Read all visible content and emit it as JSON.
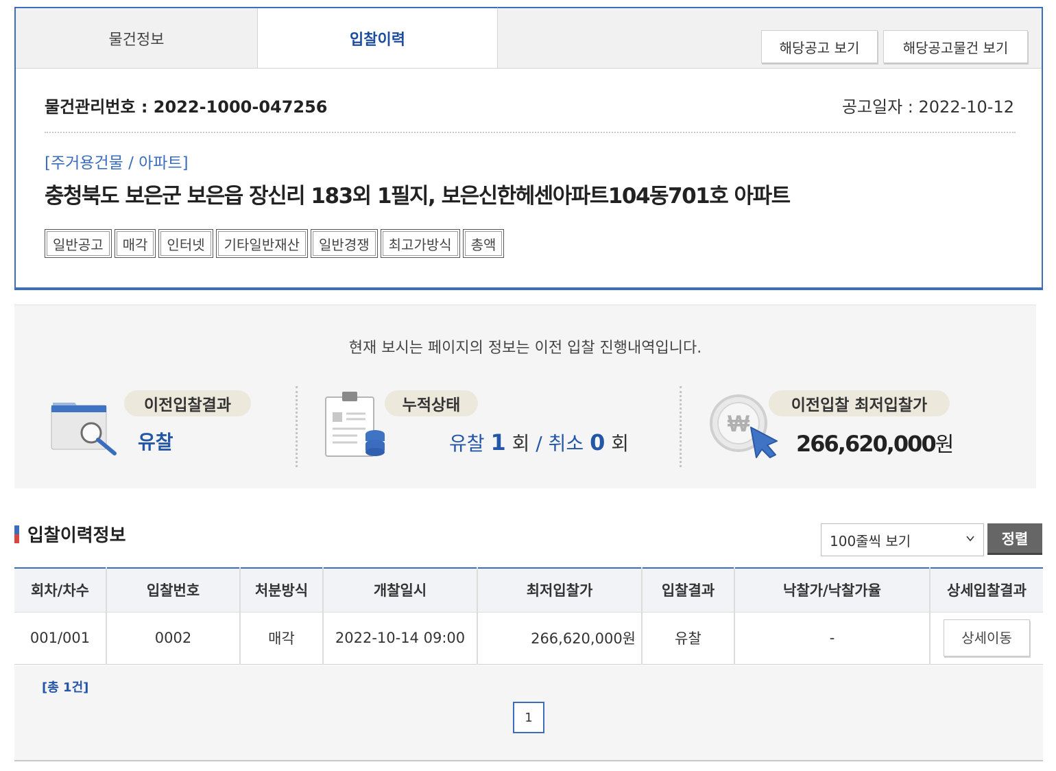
{
  "tabs": [
    {
      "label": "물건정보",
      "active": false
    },
    {
      "label": "입찰이력",
      "active": true
    }
  ],
  "header_buttons": {
    "notice_view": "해당공고 보기",
    "notice_items_view": "해당공고물건 보기"
  },
  "item": {
    "management_number_label": "물건관리번호 :",
    "management_number": "2022-1000-047256",
    "notice_date_label": "공고일자 :",
    "notice_date": "2022-10-12",
    "category": "[주거용건물 / 아파트]",
    "address": "충청북도 보은군 보은읍 장신리 183외 1필지, 보은신한헤센아파트104동701호 아파트",
    "tags": [
      "일반공고",
      "매각",
      "인터넷",
      "기타일반재산",
      "일반경쟁",
      "최고가방식",
      "총액"
    ]
  },
  "summary": {
    "notice": "현재 보시는 페이지의 정보는 이전 입찰 진행내역입니다.",
    "prev_result_label": "이전입찰결과",
    "prev_result_value": "유찰",
    "cumulative_label": "누적상태",
    "fail_label": "유찰",
    "fail_count": "1",
    "times_unit": "회",
    "separator": "/",
    "cancel_label": "취소",
    "cancel_count": "0",
    "min_price_label": "이전입찰 최저입찰가",
    "min_price_value": "266,620,000",
    "won": "원"
  },
  "section": {
    "title": "입찰이력정보",
    "rows_select": "100줄씩 보기",
    "sort_button": "정렬"
  },
  "table": {
    "headers": [
      "회차/차수",
      "입찰번호",
      "처분방식",
      "개찰일시",
      "최저입찰가",
      "입찰결과",
      "낙찰가/낙찰가율",
      "상세입찰결과"
    ],
    "rows": [
      {
        "round": "001/001",
        "bid_no": "0002",
        "method": "매각",
        "open_datetime": "2022-10-14 09:00",
        "min_price": "266,620,000원",
        "result": "유찰",
        "winning": "-",
        "detail_button": "상세이동"
      }
    ]
  },
  "footer": {
    "total": "[총 1건]",
    "page": "1"
  },
  "colors": {
    "accent_blue": "#3a6dbd",
    "text_blue": "#2456a8",
    "accent_red": "#d9463e"
  }
}
